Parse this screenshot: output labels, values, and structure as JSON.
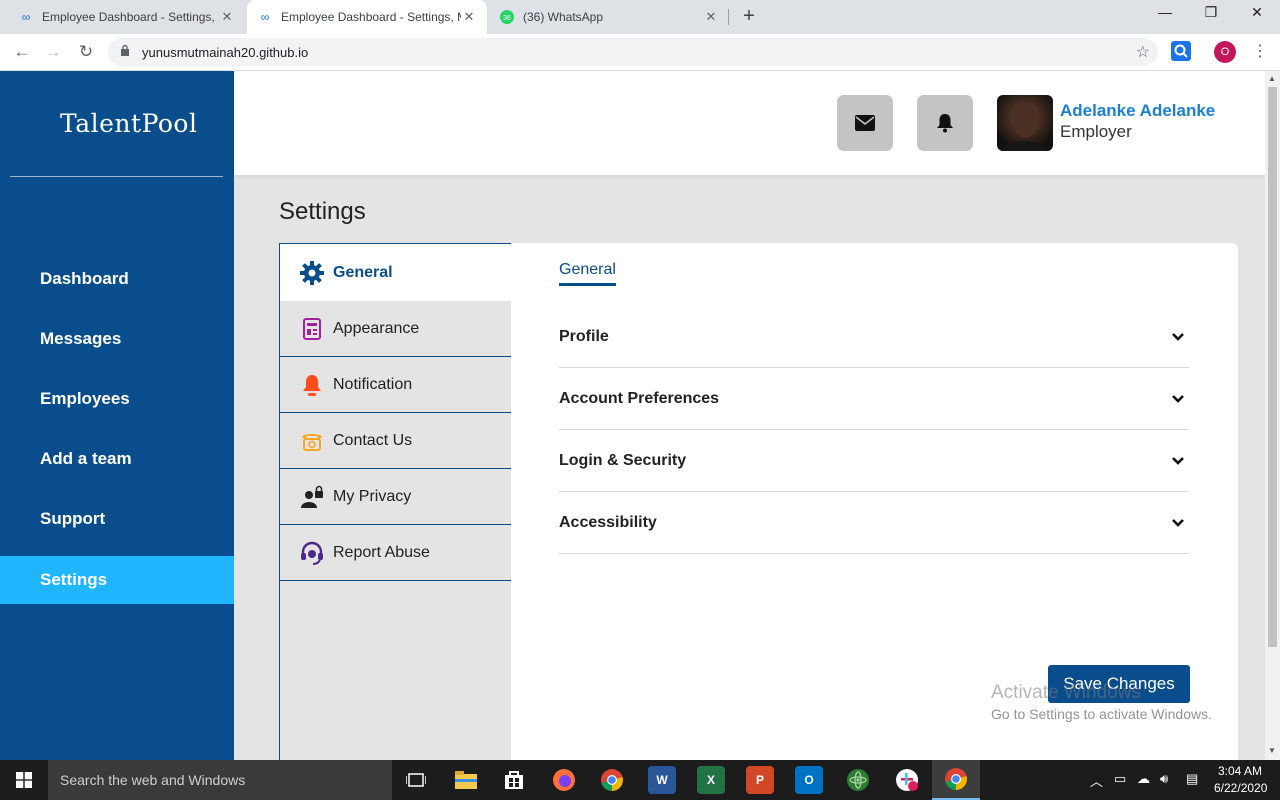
{
  "browser": {
    "tabs": [
      {
        "title": "Employee Dashboard - Settings, M",
        "icon": "infinity-icon"
      },
      {
        "title": "Employee Dashboard - Settings, M",
        "icon": "infinity-icon"
      },
      {
        "title": "(36) WhatsApp",
        "icon": "whatsapp-icon",
        "badge": "36"
      }
    ],
    "url": "yunusmutmainah20.github.io",
    "profile_initial": "O"
  },
  "sidebar": {
    "logo": "TalentPool",
    "items": [
      {
        "label": "Dashboard"
      },
      {
        "label": "Messages"
      },
      {
        "label": "Employees"
      },
      {
        "label": "Add a team"
      },
      {
        "label": "Support"
      },
      {
        "label": "Settings",
        "active": true
      }
    ]
  },
  "header": {
    "user_name": "Adelanke Adelanke",
    "user_role": "Employer"
  },
  "page_title": "Settings",
  "settings_menu": [
    {
      "label": "General",
      "icon": "gear-icon"
    },
    {
      "label": "Appearance",
      "icon": "appearance-icon"
    },
    {
      "label": "Notification",
      "icon": "bell-icon"
    },
    {
      "label": "Contact Us",
      "icon": "telephone-icon"
    },
    {
      "label": "My Privacy",
      "icon": "privacy-icon"
    },
    {
      "label": "Report Abuse",
      "icon": "headset-icon"
    }
  ],
  "content": {
    "tab": "General",
    "sections": [
      "Profile",
      "Account Preferences",
      "Login & Security",
      "Accessibility"
    ],
    "save_label": "Save Changes"
  },
  "watermark": {
    "line1": "Activate Windows",
    "line2": "Go to Settings to activate Windows."
  },
  "taskbar": {
    "search_placeholder": "Search the web and Windows",
    "time": "3:04 AM",
    "date": "6/22/2020"
  },
  "colors": {
    "sidebar": "#0a4d8c",
    "active_nav": "#1fb5ff",
    "accent_blue": "#1a7fd6",
    "page_bg": "#e4e4e4"
  }
}
